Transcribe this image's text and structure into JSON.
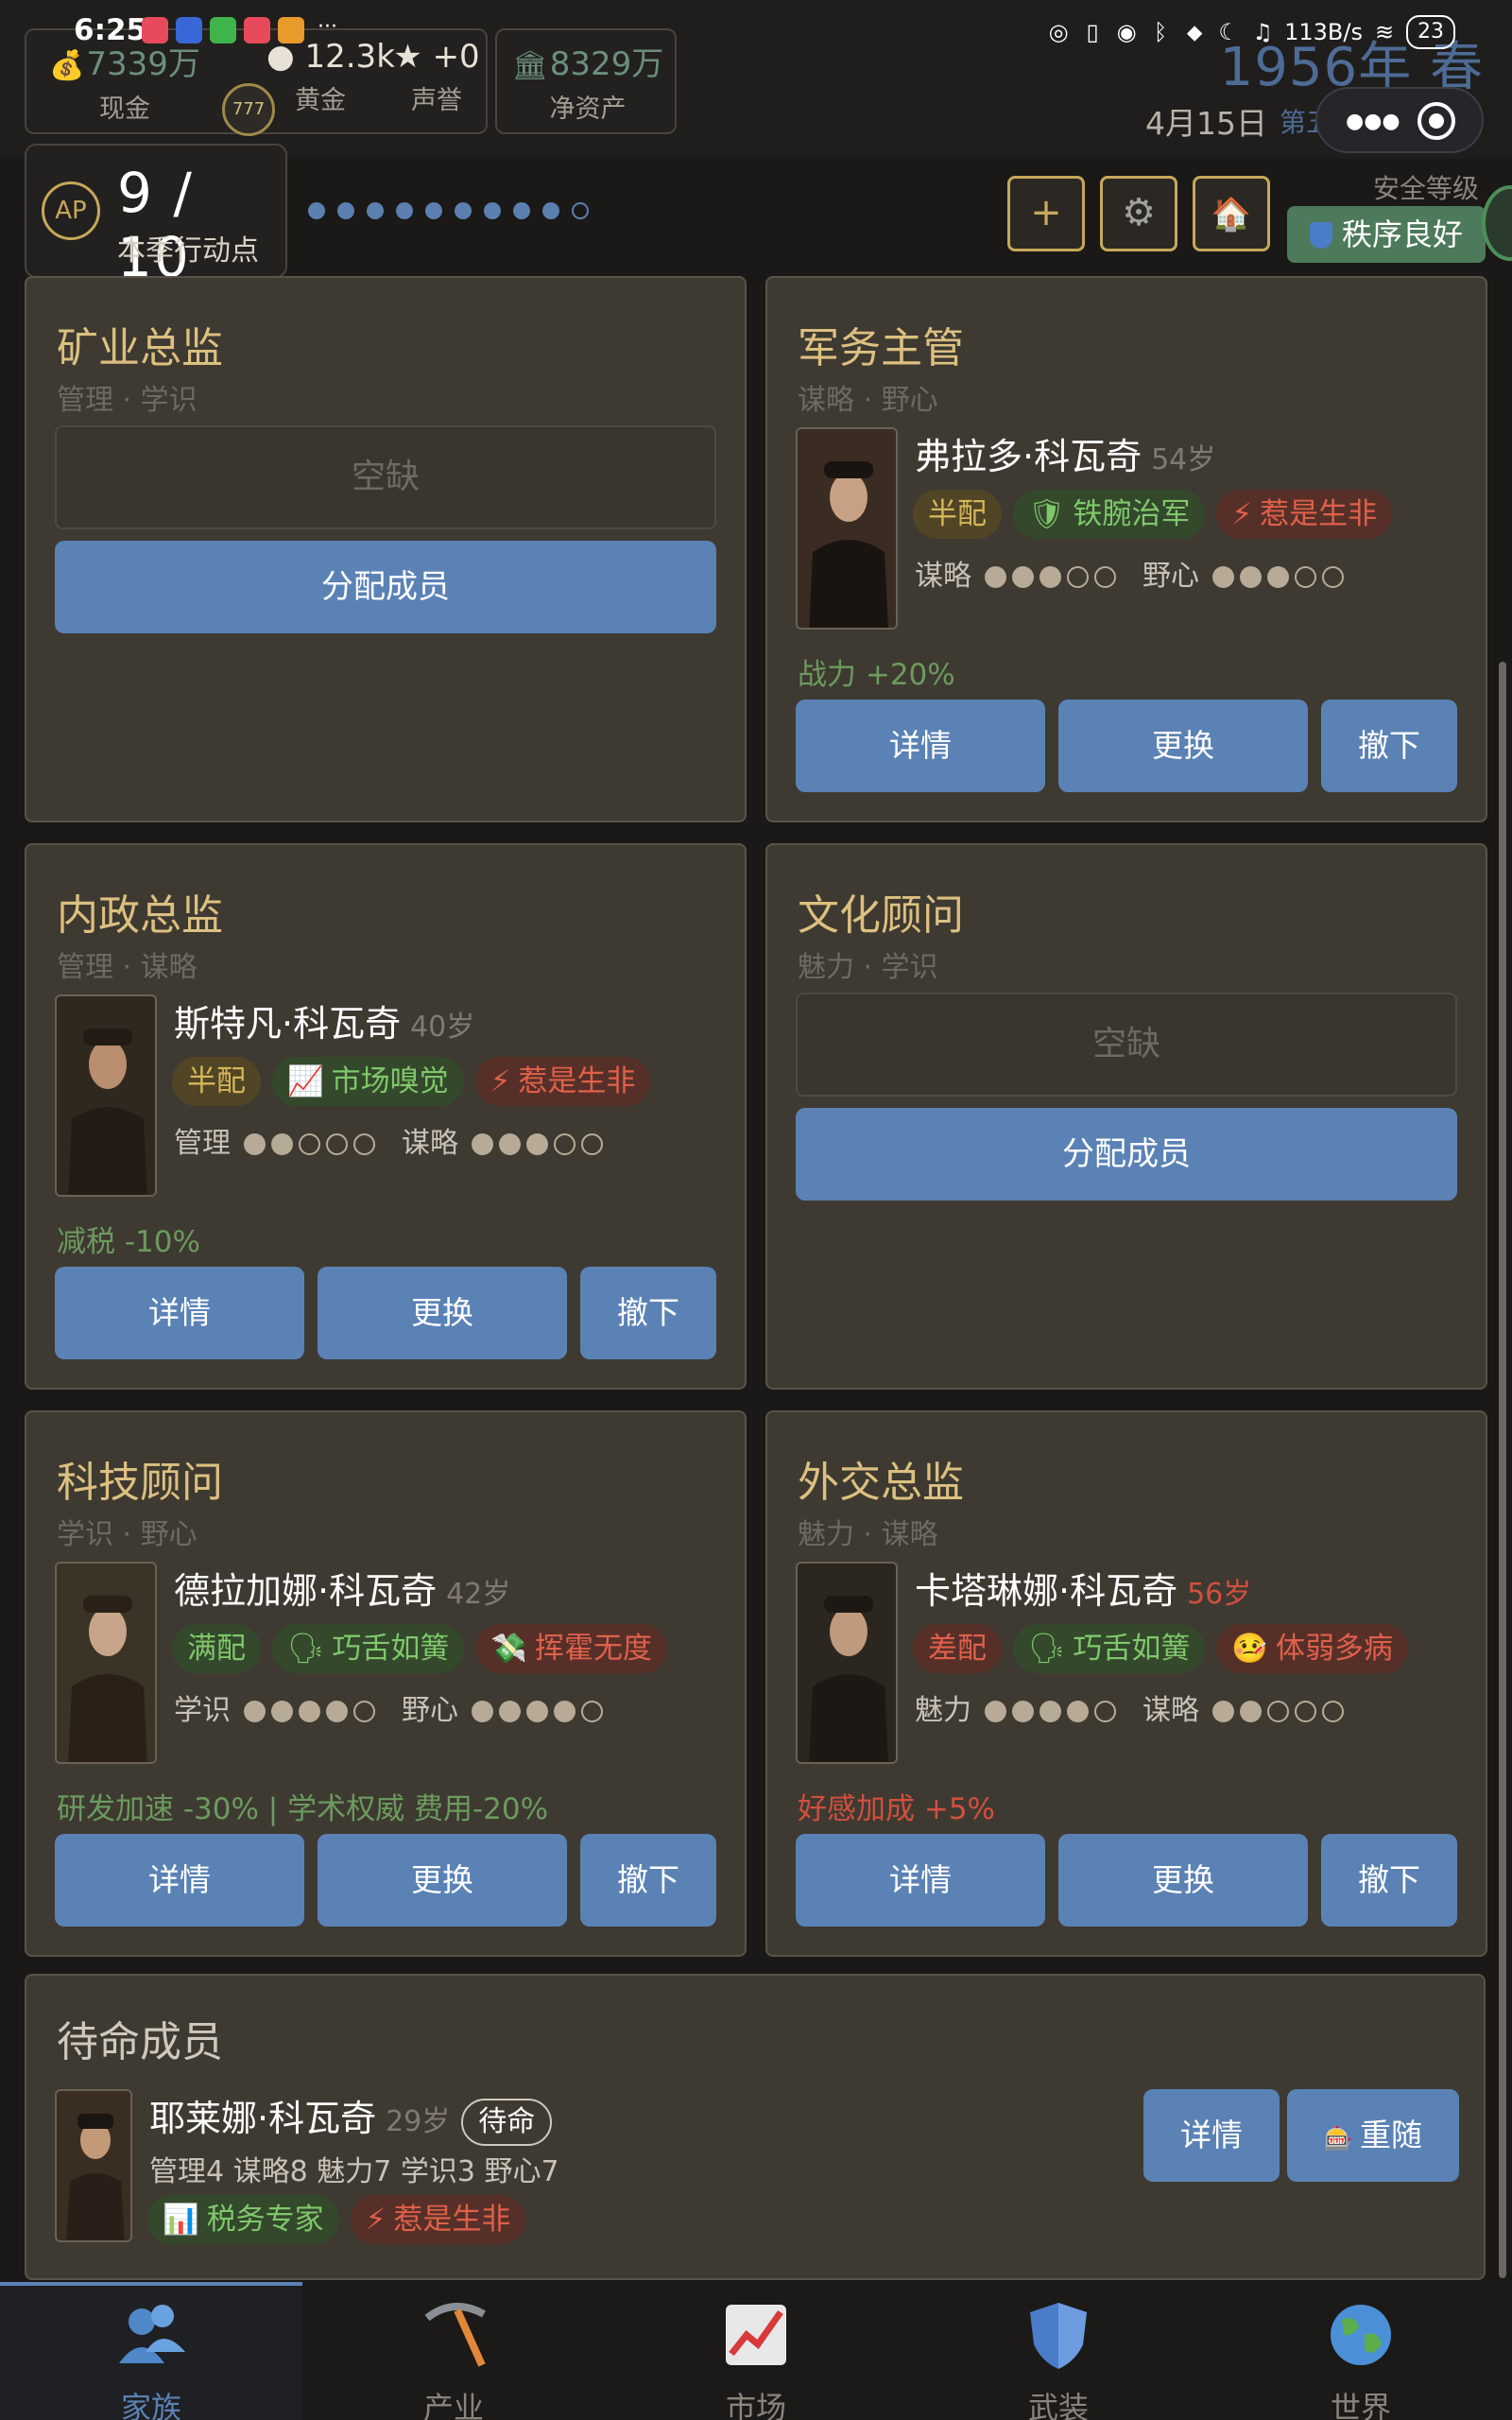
{
  "status_bar": {
    "time": "6:25",
    "more": "···",
    "net_speed": "113B/s",
    "battery": "23"
  },
  "header": {
    "cash": {
      "value": "7339万",
      "label": "现金",
      "icon": "money-bag-icon"
    },
    "gold": {
      "value": "12.3k",
      "label": "黄金"
    },
    "prestige": {
      "value": "★ +0",
      "label": "声誉"
    },
    "net_assets": {
      "value": "8329万",
      "label": "净资产",
      "icon": "bank-icon"
    },
    "avatar_text": "777",
    "year_season": "1956年 春",
    "date": "4月15日",
    "war_text": "第五年·战后恢"
  },
  "ap": {
    "badge": "AP",
    "value": "9 / 10",
    "label": "本季行动点",
    "used_dots": 9,
    "total_dots": 10
  },
  "controls": {
    "add": "+",
    "settings_icon": "gear-icon",
    "home_icon": "house-icon"
  },
  "security": {
    "label": "安全等级",
    "status": "秩序良好"
  },
  "colors": {
    "accent": "#5b82b5",
    "gold": "#dcc080",
    "green": "#6c9a5e",
    "red": "#d2503e"
  },
  "positions": [
    {
      "title": "矿业总监",
      "attr1": "管理",
      "attr2": "学识",
      "empty": true,
      "empty_label": "空缺",
      "assign_label": "分配成员"
    },
    {
      "title": "军务主管",
      "attr1": "谋略",
      "attr2": "野心",
      "empty": false,
      "name": "弗拉多·科瓦奇",
      "age": "54岁",
      "age_warn": false,
      "tags": [
        {
          "text": "半配",
          "color": "y",
          "icon": ""
        },
        {
          "text": "铁腕治军",
          "color": "g",
          "icon": "shield-icon"
        },
        {
          "text": "惹是生非",
          "color": "r",
          "icon": "lightning-icon"
        }
      ],
      "stat1": {
        "label": "谋略",
        "value": 3,
        "max": 5
      },
      "stat2": {
        "label": "野心",
        "value": 3,
        "max": 5
      },
      "effect": "战力 +20%",
      "effect_warn": false,
      "btn_details": "详情",
      "btn_replace": "更换",
      "btn_remove": "撤下"
    },
    {
      "title": "内政总监",
      "attr1": "管理",
      "attr2": "谋略",
      "empty": false,
      "name": "斯特凡·科瓦奇",
      "age": "40岁",
      "age_warn": false,
      "tags": [
        {
          "text": "半配",
          "color": "y",
          "icon": ""
        },
        {
          "text": "市场嗅觉",
          "color": "g",
          "icon": "chart-icon"
        },
        {
          "text": "惹是生非",
          "color": "r",
          "icon": "lightning-icon"
        }
      ],
      "stat1": {
        "label": "管理",
        "value": 2,
        "max": 5
      },
      "stat2": {
        "label": "谋略",
        "value": 3,
        "max": 5
      },
      "effect": "减税 -10%",
      "effect_warn": false,
      "btn_details": "详情",
      "btn_replace": "更换",
      "btn_remove": "撤下"
    },
    {
      "title": "文化顾问",
      "attr1": "魅力",
      "attr2": "学识",
      "empty": true,
      "empty_label": "空缺",
      "assign_label": "分配成员"
    },
    {
      "title": "科技顾问",
      "attr1": "学识",
      "attr2": "野心",
      "empty": false,
      "name": "德拉加娜·科瓦奇",
      "age": "42岁",
      "age_warn": false,
      "tags": [
        {
          "text": "满配",
          "color": "g",
          "icon": ""
        },
        {
          "text": "巧舌如簧",
          "color": "g",
          "icon": "speaking-head-icon"
        },
        {
          "text": "挥霍无度",
          "color": "r",
          "icon": "money-wings-icon"
        }
      ],
      "stat1": {
        "label": "学识",
        "value": 4,
        "max": 5
      },
      "stat2": {
        "label": "野心",
        "value": 4,
        "max": 5
      },
      "effect": "研发加速 -30% | 学术权威 费用-20%",
      "effect_warn": false,
      "btn_details": "详情",
      "btn_replace": "更换",
      "btn_remove": "撤下"
    },
    {
      "title": "外交总监",
      "attr1": "魅力",
      "attr2": "谋略",
      "empty": false,
      "name": "卡塔琳娜·科瓦奇",
      "age": "56岁",
      "age_warn": true,
      "tags": [
        {
          "text": "差配",
          "color": "r",
          "icon": ""
        },
        {
          "text": "巧舌如簧",
          "color": "g",
          "icon": "speaking-head-icon"
        },
        {
          "text": "体弱多病",
          "color": "r",
          "icon": "sick-face-icon"
        }
      ],
      "stat1": {
        "label": "魅力",
        "value": 4,
        "max": 5
      },
      "stat2": {
        "label": "谋略",
        "value": 2,
        "max": 5
      },
      "effect": "好感加成 +5%",
      "effect_warn": true,
      "btn_details": "详情",
      "btn_replace": "更换",
      "btn_remove": "撤下"
    }
  ],
  "reserve": {
    "title": "待命成员",
    "name": "耶莱娜·科瓦奇",
    "age": "29岁",
    "status": "待命",
    "stats": "管理4 谋略8 魅力7 学识3 野心7",
    "tags": [
      {
        "text": "税务专家",
        "color": "g",
        "icon": "bar-chart-icon"
      },
      {
        "text": "惹是生非",
        "color": "r",
        "icon": "lightning-icon"
      }
    ],
    "btn_details": "详情",
    "btn_follow": "重随",
    "follow_icon": "slot-machine-icon"
  },
  "nav": [
    {
      "label": "家族",
      "icon": "family-icon",
      "active": true
    },
    {
      "label": "产业",
      "icon": "pickaxe-icon",
      "active": false
    },
    {
      "label": "市场",
      "icon": "market-chart-icon",
      "active": false
    },
    {
      "label": "武装",
      "icon": "shield-icon",
      "active": false
    },
    {
      "label": "世界",
      "icon": "globe-icon",
      "active": false
    }
  ]
}
